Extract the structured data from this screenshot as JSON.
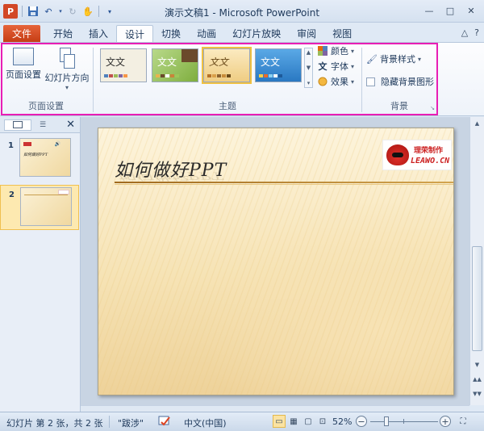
{
  "window": {
    "title": "演示文稿1 - Microsoft PowerPoint",
    "app_icon_letter": "P"
  },
  "tabs": {
    "file": "文件",
    "items": [
      "开始",
      "插入",
      "设计",
      "切换",
      "动画",
      "幻灯片放映",
      "审阅",
      "视图"
    ],
    "active": "设计"
  },
  "ribbon": {
    "page_setup": {
      "page_setup_label": "页面设置",
      "orientation_label": "幻灯片方向",
      "group_label": "页面设置"
    },
    "themes": {
      "group_label": "主题",
      "gallery": [
        {
          "text": "文文",
          "bg": "#f3efe2",
          "fg": "#333333"
        },
        {
          "text": "文文",
          "bg": "#9cc65a",
          "fg": "#ffffff"
        },
        {
          "text": "文文",
          "bg": "#f4d98c",
          "fg": "#6a4a1a",
          "selected": true
        },
        {
          "text": "文文",
          "bg": "#3c8fd6",
          "fg": "#ffffff"
        }
      ],
      "colors_label": "颜色",
      "fonts_label": "字体",
      "effects_label": "效果"
    },
    "background": {
      "group_label": "背景",
      "styles_label": "背景样式",
      "hide_graphics_label": "隐藏背景图形"
    }
  },
  "slides_pane": {
    "slides": [
      {
        "number": "1",
        "title": "如何做好PPT",
        "selected": false
      },
      {
        "number": "2",
        "title": "",
        "selected": true
      }
    ]
  },
  "slide": {
    "title": "如何做好PPT",
    "logo_cn": "理荣制作",
    "logo_en": "LEAWO.CN"
  },
  "statusbar": {
    "slide_info": "幻灯片 第 2 张，共 2 张",
    "theme_name": "\"跋涉\"",
    "language": "中文(中国)",
    "zoom": "52%"
  },
  "colors": {
    "highlight": "#e81eb5",
    "file_tab": "#d24726"
  }
}
